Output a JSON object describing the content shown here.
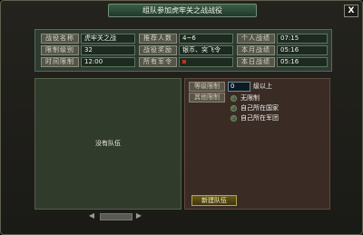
{
  "window": {
    "title": "组队参加虎牢关之战战役",
    "close_label": "X"
  },
  "info": {
    "rows": [
      [
        {
          "label": "战役名称",
          "value": "虎牢关之战"
        },
        {
          "label": "推荐人数",
          "value": "4~6"
        },
        {
          "label": "个人战绩",
          "value": "07:15"
        }
      ],
      [
        {
          "label": "限制级别",
          "value": "32"
        },
        {
          "label": "战役奖励",
          "value": "银币、突飞令"
        },
        {
          "label": "本月战绩",
          "value": "05:16"
        }
      ],
      [
        {
          "label": "时间限制",
          "value": "12:00"
        },
        {
          "label": "所有军令",
          "value": ""
        },
        {
          "label": "本日战绩",
          "value": "05:16"
        }
      ]
    ]
  },
  "team_list": {
    "empty_text": "没有队伍"
  },
  "setup": {
    "level_label": "等级限制",
    "level_value": "0",
    "level_suffix": "级以上",
    "other_label": "其他限制",
    "options": [
      {
        "label": "无限制",
        "selected": false
      },
      {
        "label": "自己所在国家",
        "selected": false
      },
      {
        "label": "自己所在军团",
        "selected": false
      }
    ],
    "create_button": "新建队伍"
  },
  "colors": {
    "accent": "#3a5e46",
    "warning_dot": "#c83020"
  }
}
